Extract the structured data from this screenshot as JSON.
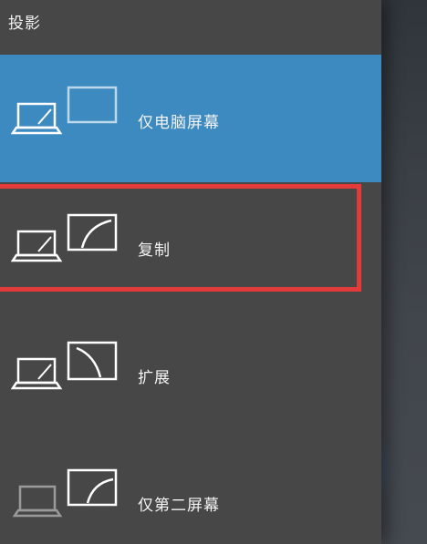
{
  "panel": {
    "title": "投影"
  },
  "options": [
    {
      "label": "仅电脑屏幕",
      "selected": true
    },
    {
      "label": "复制",
      "selected": false
    },
    {
      "label": "扩展",
      "selected": false
    },
    {
      "label": "仅第二屏幕",
      "selected": false
    }
  ],
  "colors": {
    "selected_bg": "#3d8ac0",
    "panel_bg": "#474747",
    "highlight_border": "#e33a3a"
  }
}
